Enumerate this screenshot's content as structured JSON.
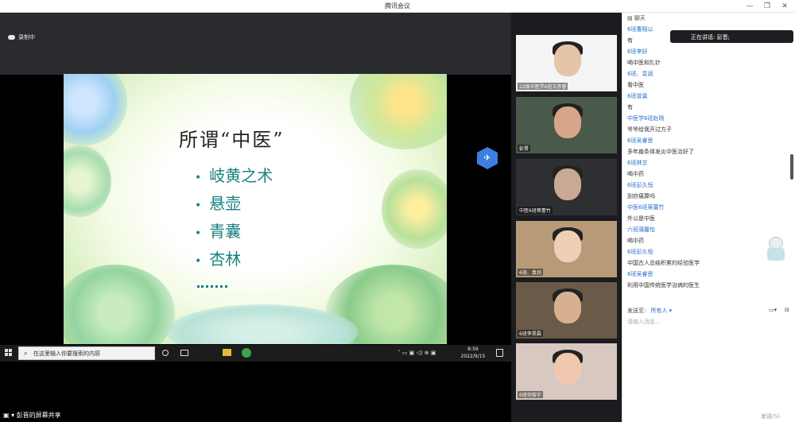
{
  "window": {
    "title": "腾讯会议"
  },
  "recording": {
    "label": "录制中"
  },
  "slide": {
    "title": "所谓“中医”",
    "bullets": [
      "岐黄之术",
      "悬壶",
      "青囊",
      "杏林"
    ]
  },
  "taskbar": {
    "search_placeholder": "在这里输入你要搜索的内容",
    "time": "8:59",
    "date": "2022/9/15"
  },
  "share": {
    "label": "彭晋的屏幕共享"
  },
  "videos": [
    {
      "name": "22级中医学6班王彦睿"
    },
    {
      "name": "彭晋"
    },
    {
      "name": "中医6班蒋蕾竹"
    },
    {
      "name": "6班、袁润"
    },
    {
      "name": "6班李昊霖"
    },
    {
      "name": "6班何俊宇"
    }
  ],
  "chat": {
    "header": "聊天",
    "speaking": "正在讲话: 彭晋;",
    "messages": [
      {
        "type": "sender",
        "text": "6班曹翔以"
      },
      {
        "type": "msg",
        "text": "有"
      },
      {
        "type": "sender",
        "text": "6班李好"
      },
      {
        "type": "msg",
        "text": "喝中医和扎针"
      },
      {
        "type": "sender",
        "text": "6班、袁润"
      },
      {
        "type": "msg",
        "text": "看中医"
      },
      {
        "type": "sender",
        "text": "6班曾巢"
      },
      {
        "type": "msg",
        "text": "有"
      },
      {
        "type": "sender",
        "text": "中医学6班赵旸"
      },
      {
        "type": "msg",
        "text": "爷爷给我开过方子"
      },
      {
        "type": "sender",
        "text": "6班吴睿思"
      },
      {
        "type": "msg",
        "text": "多年扁条体发炎中医治好了"
      },
      {
        "type": "sender",
        "text": "6班林芝"
      },
      {
        "type": "msg",
        "text": "喝中药"
      },
      {
        "type": "sender",
        "text": "6班彭久恒"
      },
      {
        "type": "msg",
        "text": "刮痧痛算吗"
      },
      {
        "type": "sender",
        "text": "中医6班蒋蕾竹"
      },
      {
        "type": "msg",
        "text": "外公是中医"
      },
      {
        "type": "sender",
        "text": "六班蒲馨怡"
      },
      {
        "type": "msg",
        "text": "喝中药"
      },
      {
        "type": "sender",
        "text": "6班彭久恒"
      },
      {
        "type": "msg",
        "text": "中国古人总结积累的经验医学"
      },
      {
        "type": "sender",
        "text": "6班吴睿思"
      },
      {
        "type": "msg",
        "text": "利用中国传统医学治病的医生"
      }
    ],
    "send_to_label": "发送至:",
    "send_to_value": "所有人",
    "input_placeholder": "请输入消息...",
    "send_button": "发送(S)"
  }
}
